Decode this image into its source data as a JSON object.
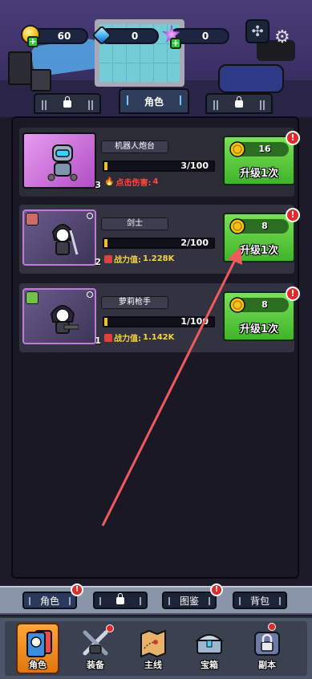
{
  "resources": [
    {
      "icon": "coin-icon",
      "value": "60"
    },
    {
      "icon": "gem-icon",
      "value": "0"
    },
    {
      "icon": "star-icon",
      "value": "0"
    }
  ],
  "top_tabs": {
    "active_label": "角色"
  },
  "characters": [
    {
      "name": "机器人炮台",
      "level": "3",
      "xp_text": "3/100",
      "xp_fraction": 0.03,
      "stat_label": "点击伤害:",
      "stat_value": "4",
      "stat_style": "damage",
      "cost": "16",
      "upgrade_label": "升级1次"
    },
    {
      "name": "剑士",
      "level": "2",
      "xp_text": "2/100",
      "xp_fraction": 0.02,
      "stat_label": "战力值:",
      "stat_value": "1.228K",
      "stat_style": "power",
      "cost": "8",
      "upgrade_label": "升级1次"
    },
    {
      "name": "萝莉枪手",
      "level": "1",
      "xp_text": "1/100",
      "xp_fraction": 0.01,
      "stat_label": "战力值:",
      "stat_value": "1.142K",
      "stat_style": "power",
      "cost": "8",
      "upgrade_label": "升级1次"
    }
  ],
  "alert_mark": "!",
  "sub_tabs": {
    "roles": "角色",
    "catalog": "图鉴",
    "backpack": "背包"
  },
  "nav": [
    {
      "label": "角色",
      "icon": "character-cards-icon",
      "active": true
    },
    {
      "label": "装备",
      "icon": "swords-icon",
      "active": false
    },
    {
      "label": "主线",
      "icon": "map-icon",
      "active": false
    },
    {
      "label": "宝箱",
      "icon": "chest-icon",
      "active": false
    },
    {
      "label": "副本",
      "icon": "locked-dungeon-icon",
      "active": false
    }
  ],
  "colors": {
    "upgrade_green": "#4fc632",
    "xp_gold": "#f0c020",
    "alert_red": "#e32a2a",
    "annotation_arrow": "#f05a5a"
  }
}
